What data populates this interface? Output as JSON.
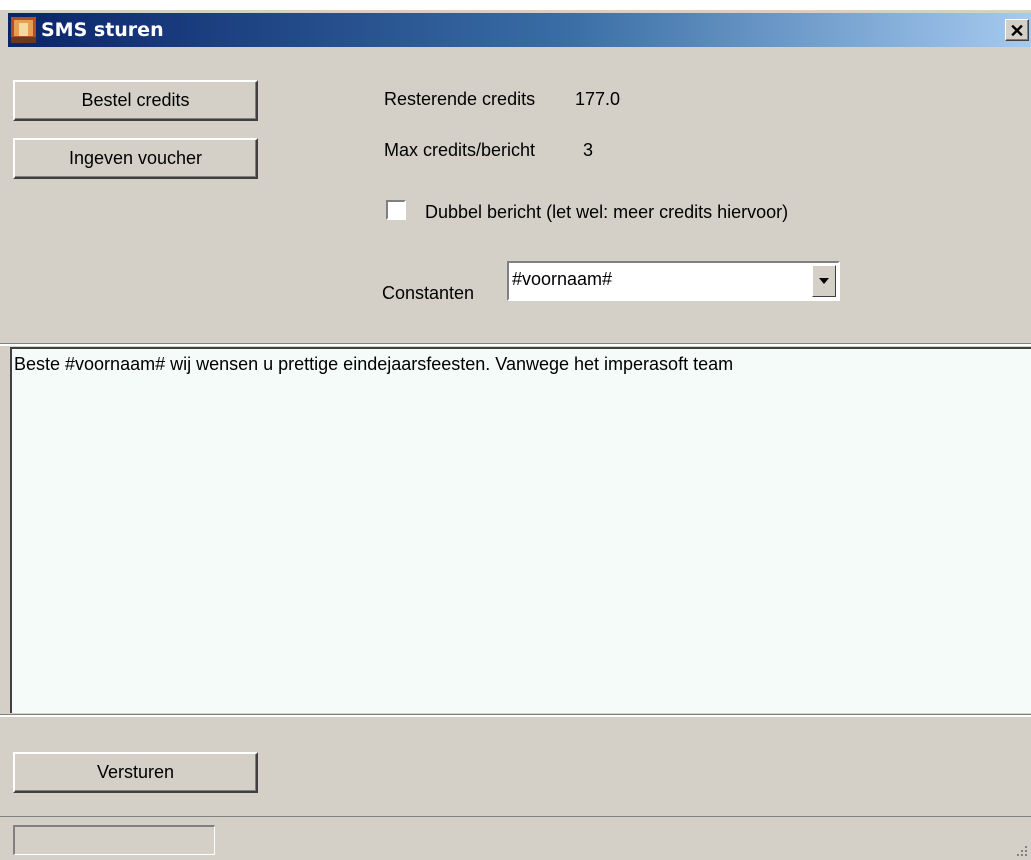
{
  "window": {
    "title": "SMS sturen",
    "close_glyph": "✕"
  },
  "buttons": {
    "bestel": "Bestel credits",
    "voucher": "Ingeven voucher",
    "versturen": "Versturen"
  },
  "credits": {
    "remaining_label": "Resterende credits",
    "remaining_value": "177.0",
    "max_label": "Max credits/bericht",
    "max_value": "3"
  },
  "checkbox": {
    "label": "Dubbel bericht (let wel: meer credits hiervoor)",
    "checked": false
  },
  "constants": {
    "label": "Constanten",
    "selected": "#voornaam#"
  },
  "message": {
    "text": "Beste #voornaam# wij wensen u prettige eindejaarsfeesten. Vanwege het imperasoft team"
  },
  "icons": {
    "app": "app-icon",
    "close": "close-icon",
    "dropdown": "chevron-down-icon",
    "grip": "resize-grip-icon"
  },
  "colors": {
    "titlebar_start": "#0a246a",
    "titlebar_end": "#a6caf0",
    "face": "#d4d0c8",
    "textarea_bg": "#f4fbf9"
  }
}
